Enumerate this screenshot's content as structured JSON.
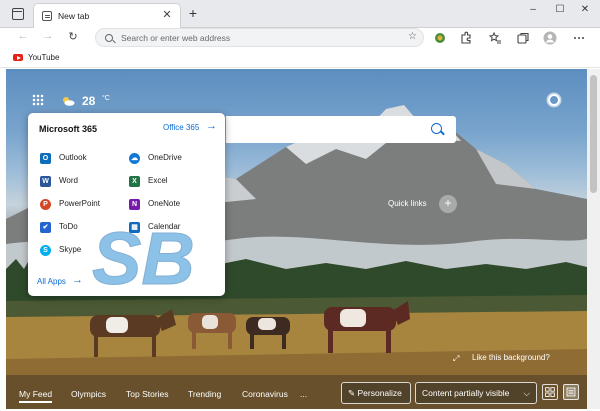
{
  "browser": {
    "tab": {
      "title": "New tab",
      "close": "✕"
    },
    "new_tab": "+",
    "window_controls": {
      "minimize": "–",
      "maximize": "☐",
      "close": "✕"
    },
    "address_bar": {
      "placeholder": "Search or enter web address"
    },
    "nav": {
      "back": "←",
      "forward": "→",
      "refresh": "↻"
    },
    "favorites": [
      {
        "label": "YouTube",
        "icon": "youtube-icon"
      }
    ]
  },
  "newtab": {
    "weather": {
      "temperature": "28",
      "unit": "°C",
      "icon": "sun-cloud-icon"
    },
    "search": {
      "placeholder": ""
    },
    "quick_links": {
      "label": "Quick links",
      "add": "+"
    },
    "background": {
      "like_label": "Like this background?"
    }
  },
  "flyout": {
    "title": "Microsoft 365",
    "office_link": "Office 365",
    "arrow": "→",
    "apps_left": [
      {
        "label": "Outlook",
        "letter": "O",
        "color": "#0f6cbd"
      },
      {
        "label": "Word",
        "letter": "W",
        "color": "#2b579a"
      },
      {
        "label": "PowerPoint",
        "letter": "P",
        "color": "#d24726"
      },
      {
        "label": "ToDo",
        "letter": "✔",
        "color": "#2564cf"
      },
      {
        "label": "Skype",
        "letter": "S",
        "color": "#00aff0"
      }
    ],
    "apps_right": [
      {
        "label": "OneDrive",
        "letter": "☁",
        "color": "#0f78d4"
      },
      {
        "label": "Excel",
        "letter": "X",
        "color": "#217346"
      },
      {
        "label": "OneNote",
        "letter": "N",
        "color": "#7719aa"
      },
      {
        "label": "Calendar",
        "letter": "▦",
        "color": "#0f6cbd"
      }
    ],
    "all_apps": "All Apps"
  },
  "feed": {
    "tabs": [
      "My Feed",
      "Olympics",
      "Top Stories",
      "Trending",
      "Coronavirus",
      "..."
    ],
    "personalize": "Personalize",
    "content_visibility": "Content partially visible",
    "chevron": "⌵"
  },
  "watermark_text": "SB"
}
